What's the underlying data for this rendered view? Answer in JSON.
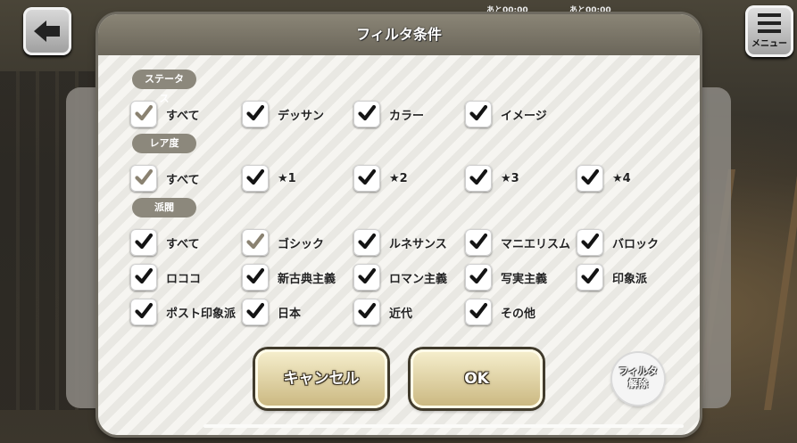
{
  "hud": {
    "menu_label": "メニュー",
    "timers": [
      "あと00:00",
      "あと00:00"
    ]
  },
  "modal": {
    "title": "フィルタ条件",
    "sections": {
      "status": {
        "label": "ステータス",
        "options": [
          {
            "label": "すべて",
            "checked": true,
            "style": "dim"
          },
          {
            "label": "デッサン",
            "checked": true
          },
          {
            "label": "カラー",
            "checked": true
          },
          {
            "label": "イメージ",
            "checked": true
          }
        ]
      },
      "rarity": {
        "label": "レア度",
        "options": [
          {
            "label": "すべて",
            "checked": true,
            "style": "dim"
          },
          {
            "label": "★1",
            "checked": true
          },
          {
            "label": "★2",
            "checked": true
          },
          {
            "label": "★3",
            "checked": true
          },
          {
            "label": "★4",
            "checked": true
          }
        ]
      },
      "school": {
        "label": "派閥",
        "options": [
          {
            "label": "すべて",
            "checked": true
          },
          {
            "label": "ゴシック",
            "checked": true,
            "style": "dim"
          },
          {
            "label": "ルネサンス",
            "checked": true
          },
          {
            "label": "マニエリスム",
            "checked": true
          },
          {
            "label": "バロック",
            "checked": true
          },
          {
            "label": "ロココ",
            "checked": true
          },
          {
            "label": "新古典主義",
            "checked": true
          },
          {
            "label": "ロマン主義",
            "checked": true
          },
          {
            "label": "写実主義",
            "checked": true
          },
          {
            "label": "印象派",
            "checked": true
          },
          {
            "label": "ポスト印象派",
            "checked": true
          },
          {
            "label": "日本",
            "checked": true
          },
          {
            "label": "近代",
            "checked": true
          },
          {
            "label": "その他",
            "checked": true
          }
        ]
      }
    },
    "buttons": {
      "cancel": "キャンセル",
      "ok": "OK",
      "clear_line1": "フィルタ",
      "clear_line2": "解除"
    }
  },
  "colors": {
    "header": "#7b7667",
    "section_label": "#8c887c",
    "button_gold": "#e3d4a2",
    "check_dark": "#141414",
    "check_dim": "#8a8271"
  }
}
